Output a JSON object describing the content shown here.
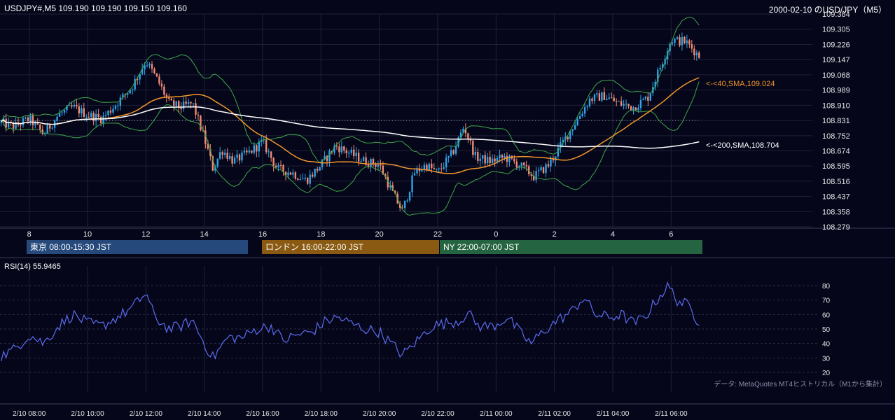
{
  "header": {
    "left": "USDJPY#,M5 109.190 109.190 109.150 109.160",
    "right": "2000-02-10 のUSD/JPY（M5）"
  },
  "sessions": [
    {
      "label": "東京 08:00-15:30 JST",
      "color": "#24497a"
    },
    {
      "label": "ロンドン 16:00-22:00 JST",
      "color": "#8a5a12"
    },
    {
      "label": "NY 22:00-07:00 JST",
      "color": "#256440"
    }
  ],
  "indicator_labels": {
    "sma40": "<-<40,SMA,109.024",
    "sma200": "<-<200,SMA,108.704"
  },
  "rsi_label": "RSI(14) 55.9465",
  "footer_note": "データ: MetaQuotes MT4ヒストリカル（M1から集計）",
  "colors": {
    "background": "#05061a",
    "up_candle": "#2ea3e6",
    "down_candle": "#f08a72",
    "sma40": "#f0962a",
    "sma200": "#ffffff",
    "bollinger": "#3fa64a",
    "rsi": "#5c6cf0",
    "grid": "#1f2138"
  },
  "chart_data": [
    {
      "type": "candlestick",
      "symbol": "USDJPY#",
      "timeframe": "M5",
      "last_ohlc": {
        "open": 109.19,
        "high": 109.19,
        "low": 109.15,
        "close": 109.16
      },
      "y_ticks": [
        108.279,
        108.358,
        108.437,
        108.516,
        108.595,
        108.674,
        108.752,
        108.831,
        108.91,
        108.989,
        109.068,
        109.147,
        109.226,
        109.305,
        109.384
      ],
      "ylim": [
        108.279,
        109.384
      ],
      "x_ticks": [
        "8",
        "10",
        "12",
        "14",
        "16",
        "18",
        "20",
        "22",
        "0",
        "2",
        "4",
        "6"
      ],
      "x_tick_hours": [
        8,
        10,
        12,
        14,
        16,
        18,
        20,
        22,
        24,
        26,
        28,
        30
      ],
      "xlim_hours": [
        7.0,
        31.0
      ],
      "reference_line": 108.831,
      "series": [
        {
          "name": "40,SMA",
          "last": 109.024
        },
        {
          "name": "200,SMA",
          "last": 108.704
        }
      ],
      "bollinger": true,
      "price_path": [
        [
          7.0,
          108.82
        ],
        [
          7.5,
          108.8
        ],
        [
          8.0,
          108.84
        ],
        [
          8.5,
          108.76
        ],
        [
          9.0,
          108.86
        ],
        [
          9.5,
          108.9
        ],
        [
          10.0,
          108.86
        ],
        [
          10.5,
          108.84
        ],
        [
          11.0,
          108.92
        ],
        [
          11.5,
          109.0
        ],
        [
          12.0,
          109.14
        ],
        [
          12.4,
          109.04
        ],
        [
          12.8,
          108.92
        ],
        [
          13.2,
          108.9
        ],
        [
          13.6,
          108.92
        ],
        [
          14.0,
          108.74
        ],
        [
          14.3,
          108.58
        ],
        [
          14.6,
          108.68
        ],
        [
          15.0,
          108.62
        ],
        [
          15.5,
          108.66
        ],
        [
          16.0,
          108.72
        ],
        [
          16.5,
          108.58
        ],
        [
          17.0,
          108.56
        ],
        [
          17.5,
          108.52
        ],
        [
          18.0,
          108.6
        ],
        [
          18.5,
          108.7
        ],
        [
          19.0,
          108.66
        ],
        [
          19.5,
          108.62
        ],
        [
          20.0,
          108.6
        ],
        [
          20.5,
          108.44
        ],
        [
          20.8,
          108.36
        ],
        [
          21.2,
          108.56
        ],
        [
          21.6,
          108.6
        ],
        [
          22.0,
          108.56
        ],
        [
          22.5,
          108.66
        ],
        [
          22.9,
          108.8
        ],
        [
          23.3,
          108.64
        ],
        [
          23.8,
          108.62
        ],
        [
          24.3,
          108.64
        ],
        [
          24.8,
          108.6
        ],
        [
          25.3,
          108.54
        ],
        [
          25.8,
          108.6
        ],
        [
          26.3,
          108.72
        ],
        [
          26.8,
          108.84
        ],
        [
          27.2,
          108.94
        ],
        [
          27.7,
          108.96
        ],
        [
          28.2,
          108.92
        ],
        [
          28.7,
          108.9
        ],
        [
          29.2,
          108.95
        ],
        [
          29.6,
          109.1
        ],
        [
          30.0,
          109.25
        ],
        [
          30.5,
          109.24
        ],
        [
          31.0,
          109.16
        ]
      ]
    },
    {
      "type": "line",
      "name": "RSI(14)",
      "last": 55.9465,
      "y_ticks": [
        20,
        30,
        40,
        50,
        60,
        70,
        80
      ],
      "ylim": [
        20,
        80
      ],
      "rsi_path": [
        [
          7.0,
          31
        ],
        [
          7.5,
          36
        ],
        [
          8.0,
          46
        ],
        [
          8.5,
          40
        ],
        [
          9.0,
          52
        ],
        [
          9.5,
          60
        ],
        [
          10.0,
          54
        ],
        [
          10.5,
          52
        ],
        [
          11.0,
          58
        ],
        [
          11.5,
          64
        ],
        [
          12.0,
          75
        ],
        [
          12.3,
          58
        ],
        [
          12.8,
          50
        ],
        [
          13.2,
          52
        ],
        [
          13.6,
          56
        ],
        [
          14.0,
          40
        ],
        [
          14.3,
          30
        ],
        [
          14.8,
          44
        ],
        [
          15.3,
          44
        ],
        [
          15.8,
          50
        ],
        [
          16.3,
          52
        ],
        [
          16.7,
          42
        ],
        [
          17.2,
          46
        ],
        [
          17.7,
          48
        ],
        [
          18.2,
          56
        ],
        [
          18.6,
          58
        ],
        [
          19.0,
          54
        ],
        [
          19.5,
          50
        ],
        [
          20.0,
          48
        ],
        [
          20.4,
          40
        ],
        [
          20.8,
          32
        ],
        [
          21.3,
          42
        ],
        [
          21.8,
          52
        ],
        [
          22.3,
          54
        ],
        [
          22.8,
          56
        ],
        [
          23.0,
          62
        ],
        [
          23.4,
          52
        ],
        [
          23.9,
          52
        ],
        [
          24.4,
          58
        ],
        [
          24.8,
          48
        ],
        [
          25.2,
          40
        ],
        [
          25.6,
          48
        ],
        [
          26.1,
          56
        ],
        [
          26.6,
          62
        ],
        [
          27.0,
          72
        ],
        [
          27.4,
          60
        ],
        [
          27.9,
          58
        ],
        [
          28.3,
          60
        ],
        [
          28.7,
          54
        ],
        [
          29.1,
          58
        ],
        [
          29.5,
          70
        ],
        [
          29.9,
          80
        ],
        [
          30.2,
          70
        ],
        [
          30.6,
          66
        ],
        [
          30.9,
          56
        ]
      ],
      "x_ticks": [
        "2/10 08:00",
        "2/10 10:00",
        "2/10 12:00",
        "2/10 14:00",
        "2/10 16:00",
        "2/10 18:00",
        "2/10 20:00",
        "2/10 22:00",
        "2/11 00:00",
        "2/11 02:00",
        "2/11 04:00",
        "2/11 06:00"
      ]
    }
  ]
}
